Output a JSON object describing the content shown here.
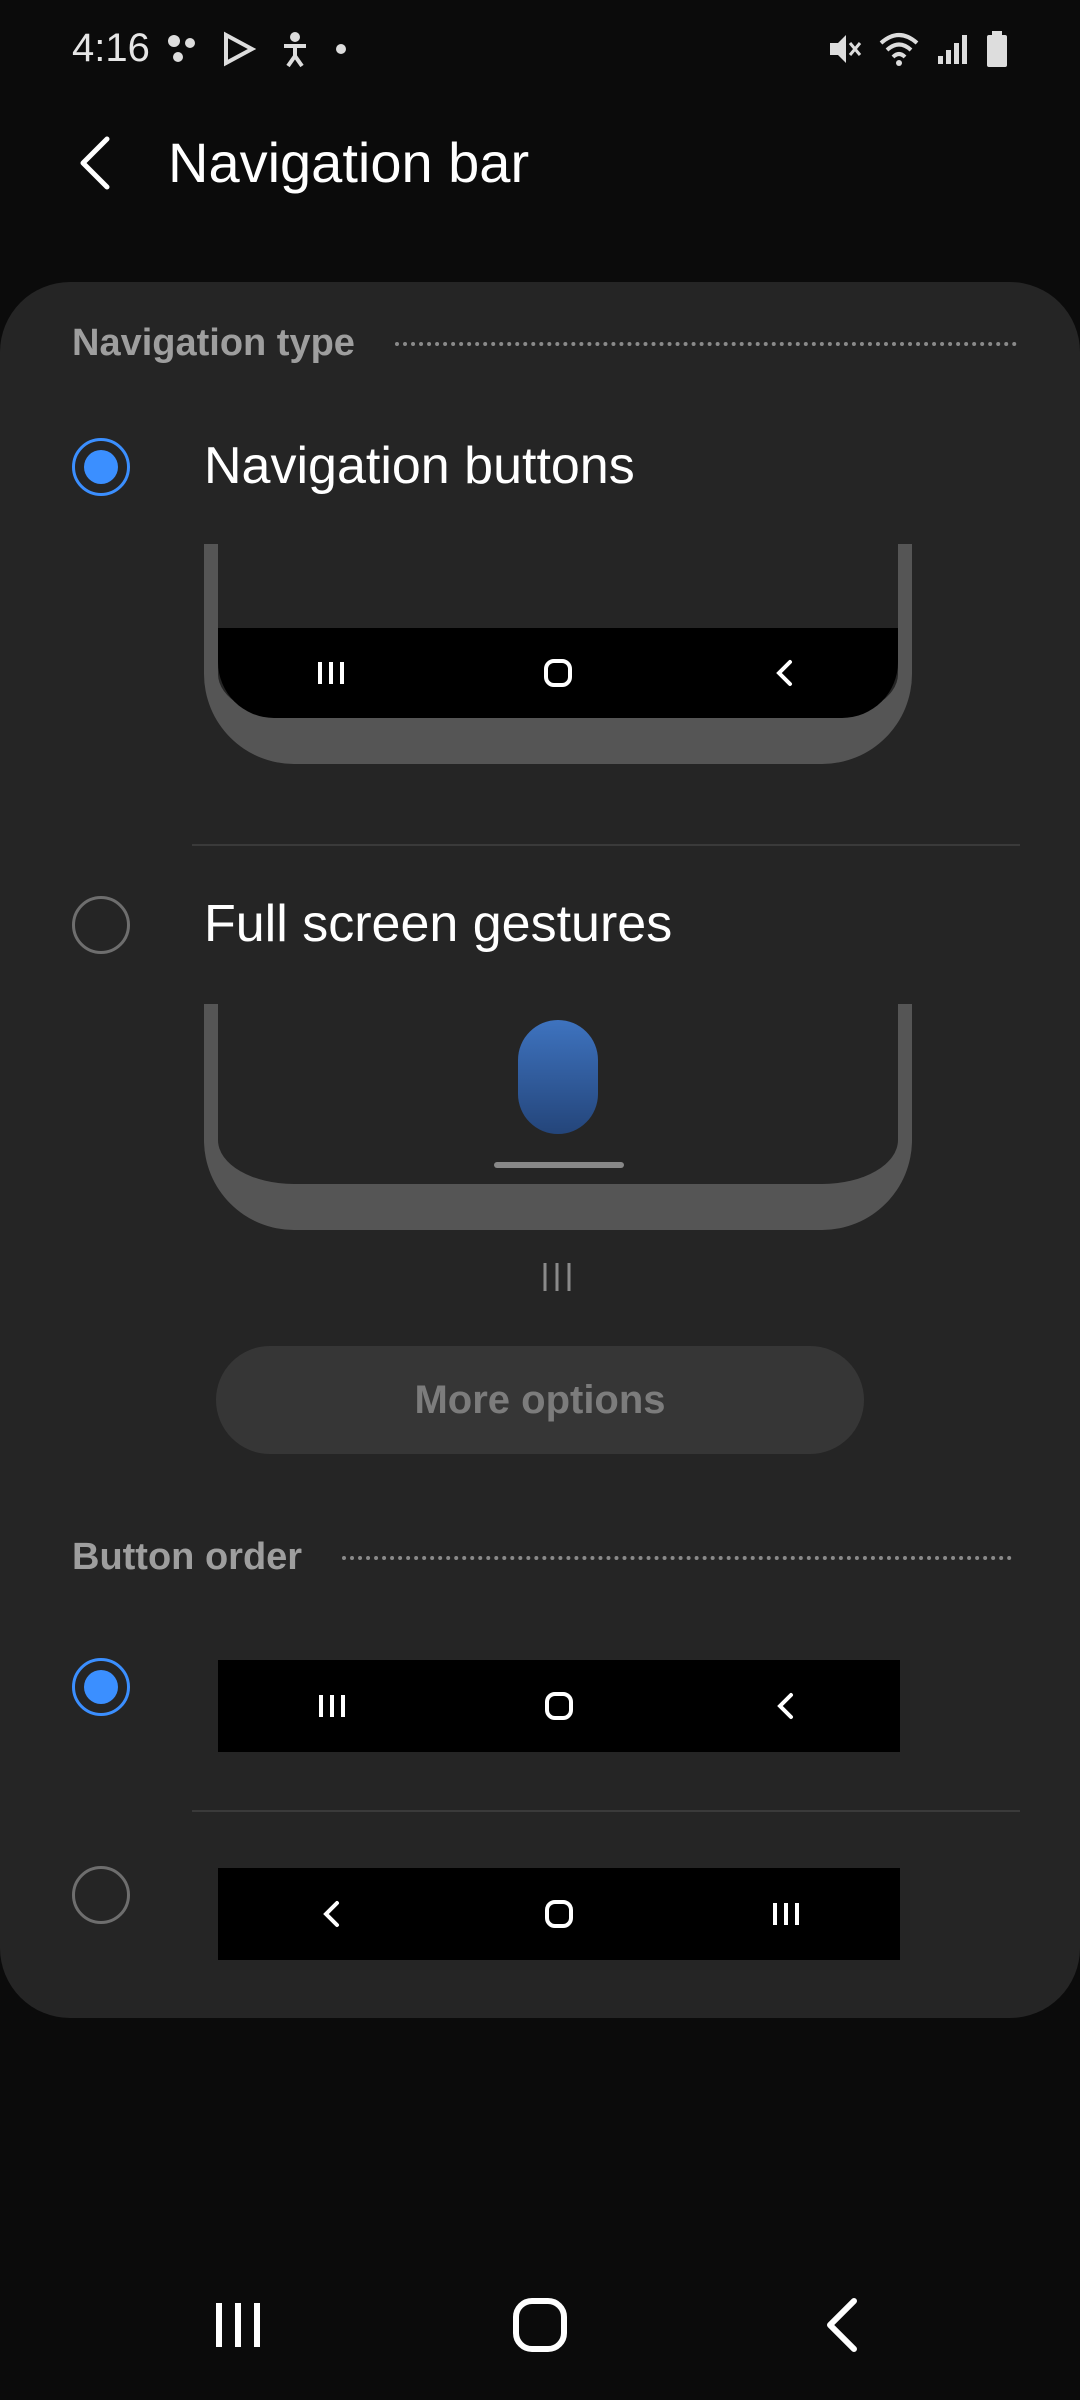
{
  "status_bar": {
    "time": "4:16",
    "left_icons": [
      "notification-icon",
      "play-store-icon",
      "accessibility-icon",
      "dot-icon"
    ],
    "right_icons": [
      "mute-icon",
      "wifi-icon",
      "signal-icon",
      "battery-icon"
    ]
  },
  "header": {
    "title": "Navigation bar",
    "back_icon": "chevron-left-icon"
  },
  "navigation_type": {
    "section_title": "Navigation type",
    "options": [
      {
        "label": "Navigation buttons",
        "selected": true
      },
      {
        "label": "Full screen gestures",
        "selected": false
      }
    ],
    "gesture_hint_icon": "recents-lines-icon",
    "more_options_label": "More options"
  },
  "button_order": {
    "section_title": "Button order",
    "options": [
      {
        "selected": true,
        "order": [
          "recents-icon",
          "home-icon",
          "back-icon"
        ]
      },
      {
        "selected": false,
        "order": [
          "back-icon",
          "home-icon",
          "recents-icon"
        ]
      }
    ]
  },
  "system_nav": {
    "buttons": [
      "recents-icon",
      "home-icon",
      "back-icon"
    ]
  },
  "colors": {
    "accent": "#3b8fff",
    "card": "#252525",
    "background": "#0b0b0b"
  }
}
